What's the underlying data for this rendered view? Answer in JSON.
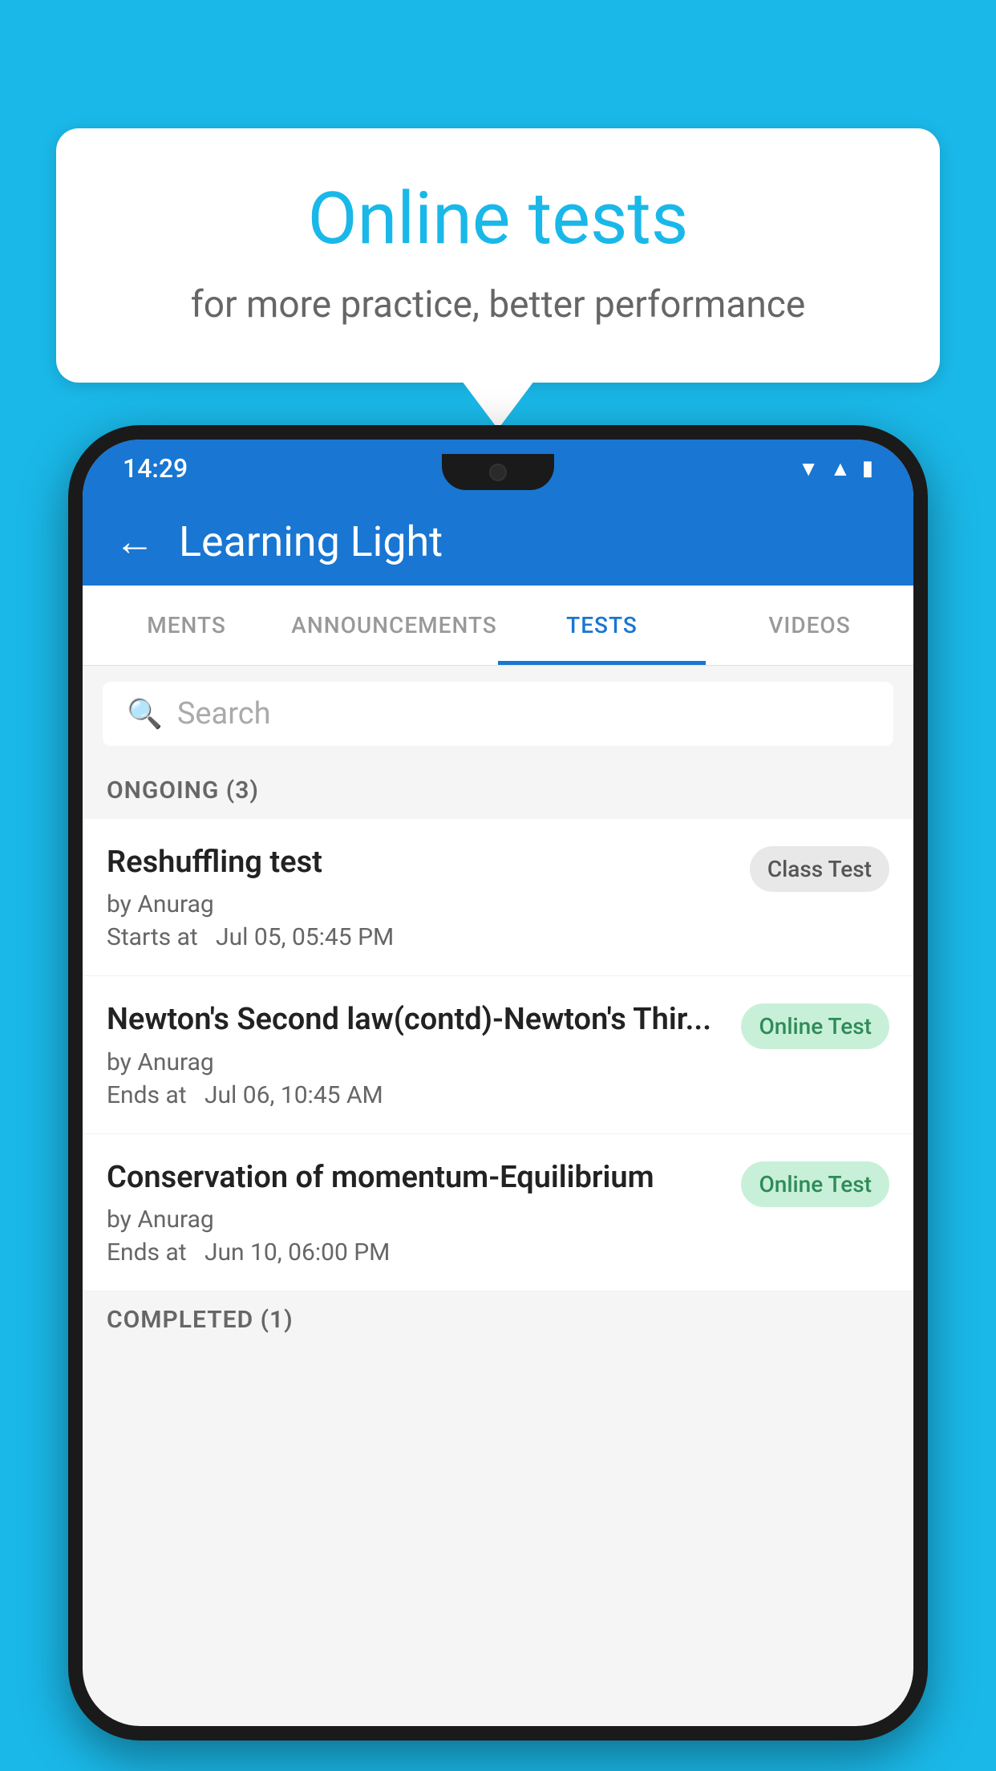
{
  "background_color": "#1ab8e8",
  "speech_bubble": {
    "title": "Online tests",
    "subtitle": "for more practice, better performance"
  },
  "status_bar": {
    "time": "14:29",
    "icons": [
      "wifi",
      "signal",
      "battery"
    ]
  },
  "app_header": {
    "back_label": "←",
    "title": "Learning Light"
  },
  "tabs": [
    {
      "label": "MENTS",
      "active": false
    },
    {
      "label": "ANNOUNCEMENTS",
      "active": false
    },
    {
      "label": "TESTS",
      "active": true
    },
    {
      "label": "VIDEOS",
      "active": false
    }
  ],
  "search": {
    "placeholder": "Search"
  },
  "ongoing_section": {
    "label": "ONGOING (3)"
  },
  "tests": [
    {
      "name": "Reshuffling test",
      "author": "by Anurag",
      "time_label": "Starts at",
      "time": "Jul 05, 05:45 PM",
      "badge": "Class Test",
      "badge_type": "class"
    },
    {
      "name": "Newton's Second law(contd)-Newton's Thir...",
      "author": "by Anurag",
      "time_label": "Ends at",
      "time": "Jul 06, 10:45 AM",
      "badge": "Online Test",
      "badge_type": "online"
    },
    {
      "name": "Conservation of momentum-Equilibrium",
      "author": "by Anurag",
      "time_label": "Ends at",
      "time": "Jun 10, 06:00 PM",
      "badge": "Online Test",
      "badge_type": "online"
    }
  ],
  "completed_section": {
    "label": "COMPLETED (1)"
  }
}
